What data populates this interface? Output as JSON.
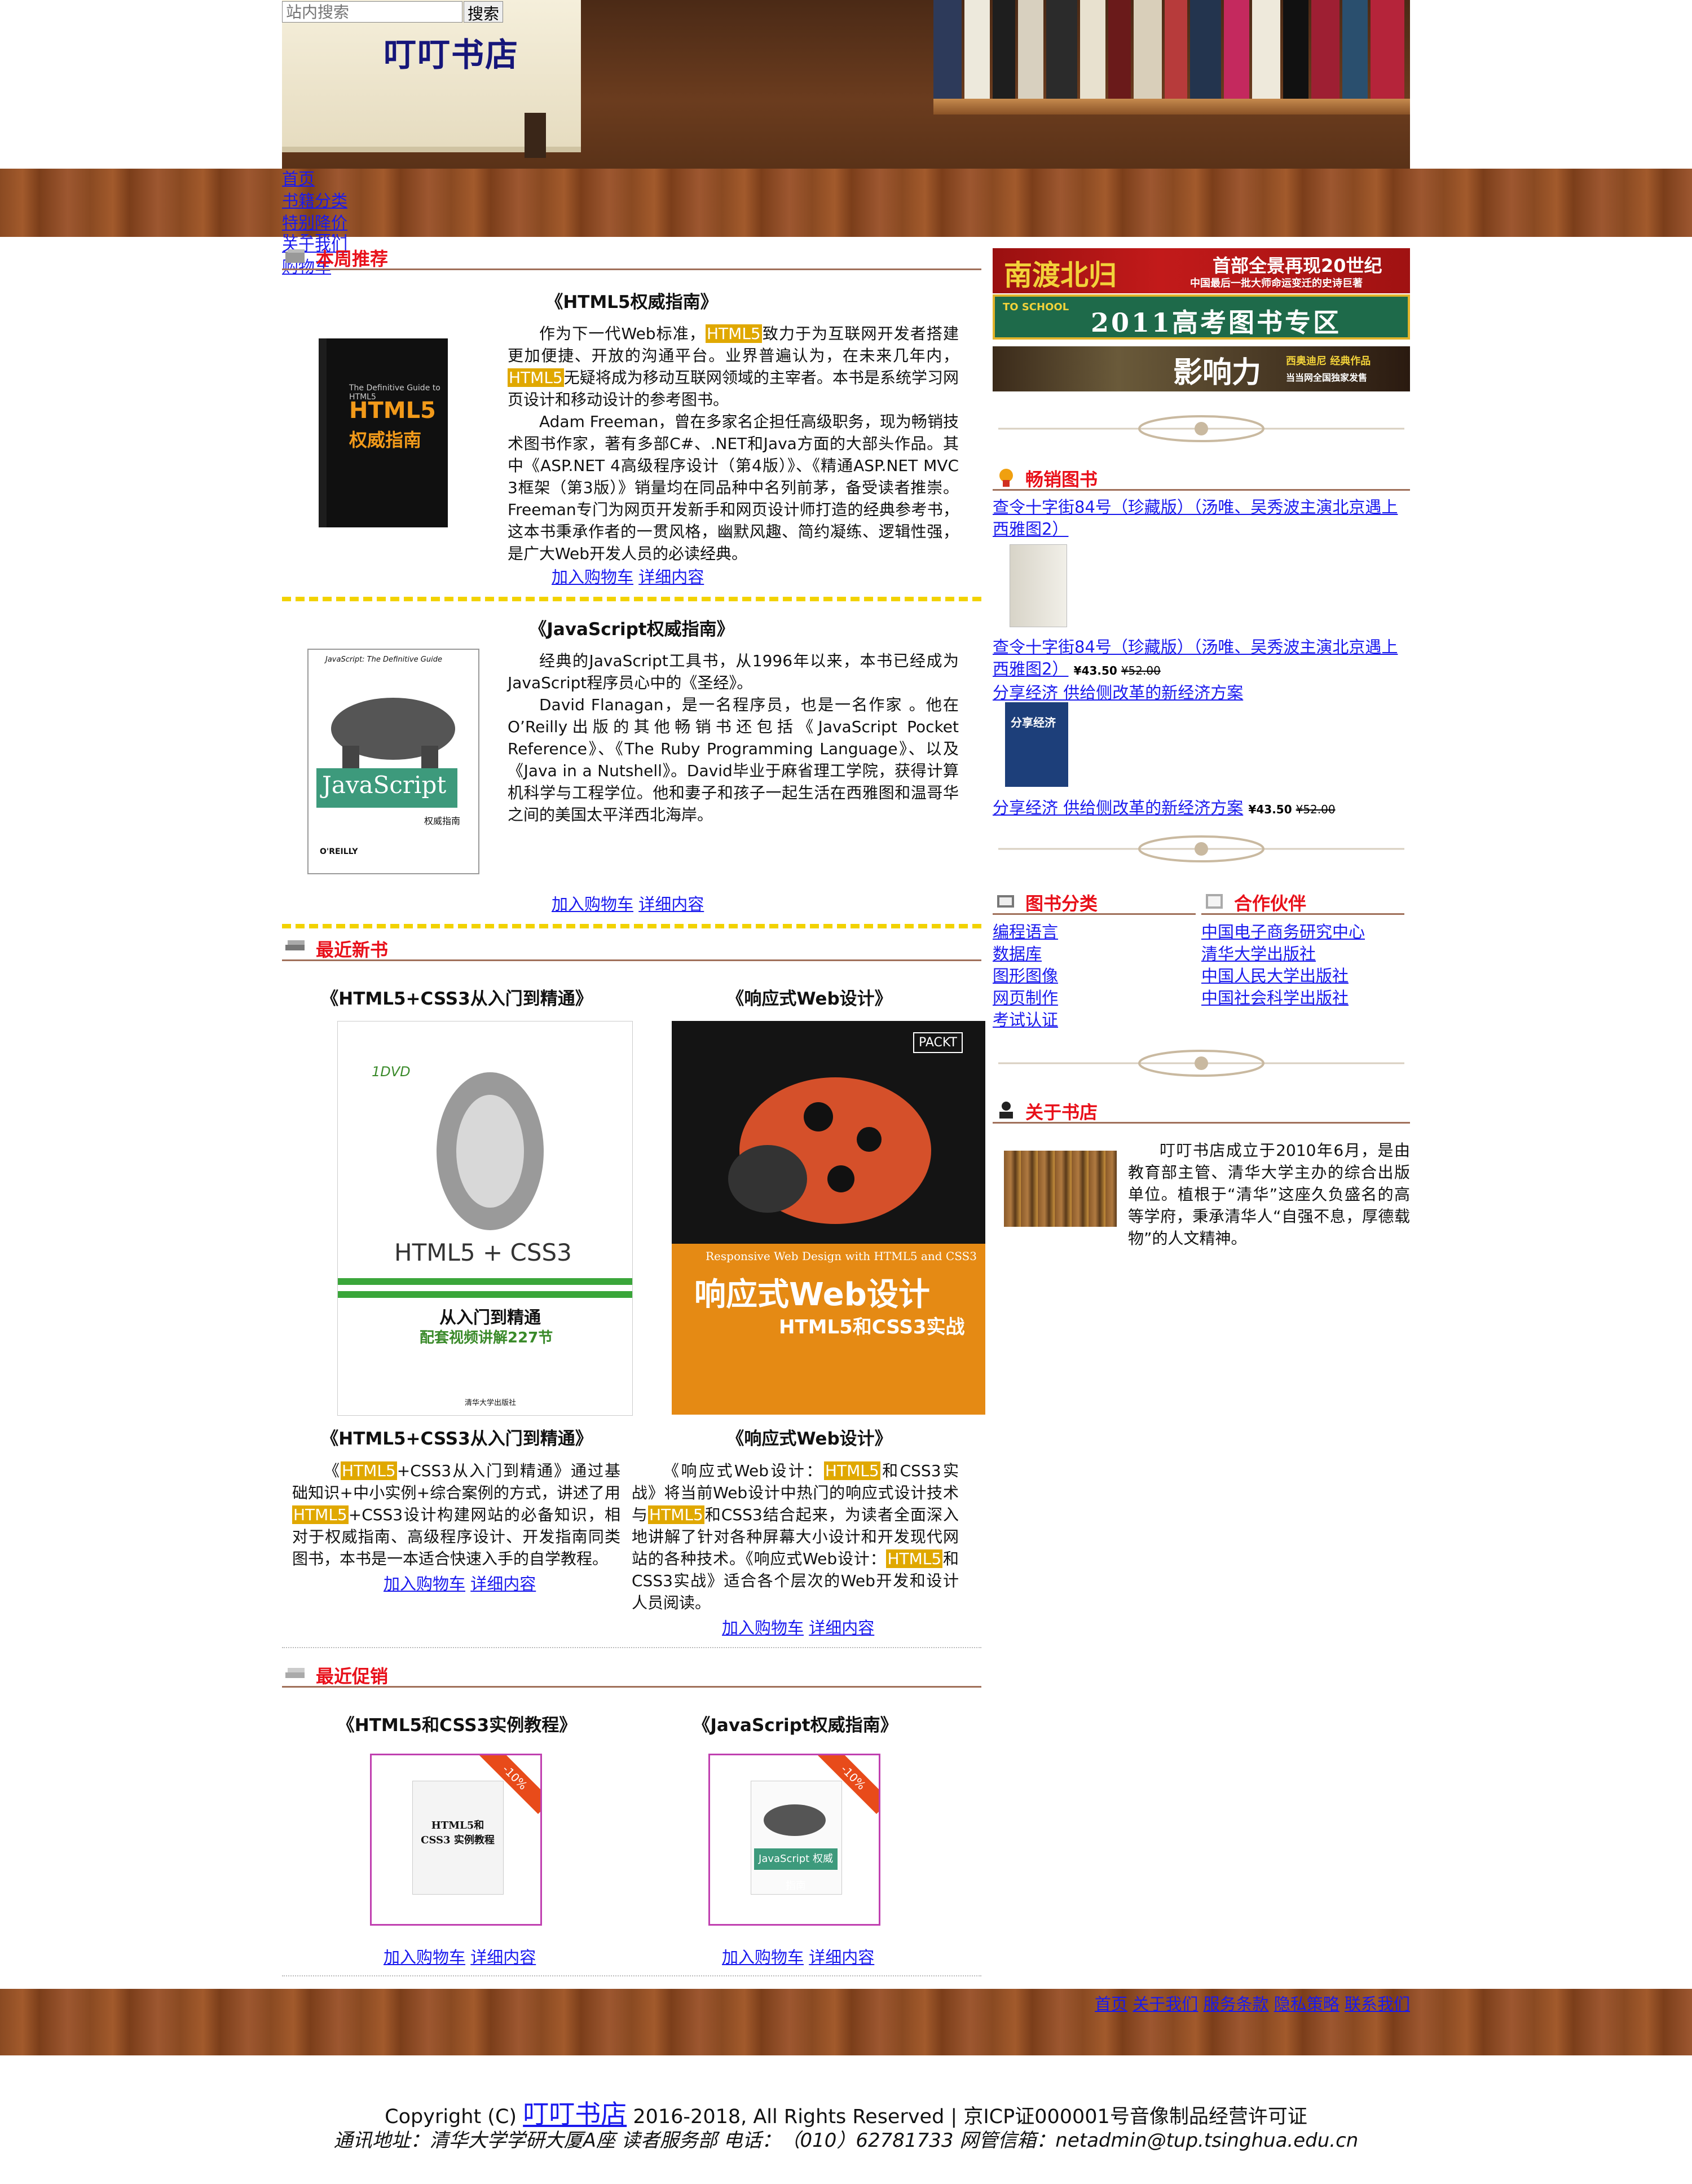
{
  "header": {
    "search_placeholder": "站内搜索",
    "search_button": "搜索",
    "site_title": "叮叮书店"
  },
  "nav": [
    "首页",
    "书籍分类",
    "特别降价",
    "联系我们",
    "关于我们",
    "购物车"
  ],
  "recommend": {
    "title": "本周推荐",
    "books": [
      {
        "title": "《HTML5权威指南》",
        "paragraphs": [
          [
            "作为下一代Web标准，",
            "HTML5",
            "致力于为互联网开发者搭建更加便捷、开放的沟通平台。业界普遍认为，在未来几年内，",
            "HTML5",
            "无疑将成为移动互联网领域的主宰者。本书是系统学习网页设计和移动设计的参考图书。"
          ],
          [
            "Adam Freeman，曾在多家名企担任高级职务，现为畅销技术图书作家，著有多部C#、.NET和Java方面的大部头作品。其中《ASP.NET 4高级程序设计（第4版）》、《精通ASP.NET MVC 3框架（第3版）》销量均在同品种中名列前茅，备受读者推崇。Freeman专门为网页开发新手和网页设计师打造的经典参考书，这本书秉承作者的一贯风格，幽默风趣、简约凝练、逻辑性强，是广大Web开发人员的必读经典。"
          ]
        ],
        "cover": {
          "line1": "HTML5",
          "line2": "权威指南",
          "line0": "The Definitive Guide to HTML5"
        }
      },
      {
        "title": "《JavaScript权威指南》",
        "paragraphs": [
          [
            "经典的JavaScript工具书，从1996年以来，本书已经成为JavaScript程序员心中的《圣经》。"
          ],
          [
            "David Flanagan，是一名程序员，也是一名作家 。他在O’Reilly出版的其他畅销书还包括《JavaScript Pocket Reference》、《The Ruby Programming Language》、以及《Java in a Nutshell》。David毕业于麻省理工学院，获得计算机科学与工程学位。他和妻子和孩子一起生活在西雅图和温哥华之间的美国太平洋西北海岸。"
          ]
        ],
        "cover": {
          "line0": "JavaScript: The Definitive Guide",
          "line1": "JavaScript",
          "line2": "权威指南"
        }
      }
    ],
    "add_cart": "加入购物车",
    "details": "详细内容"
  },
  "newbooks": {
    "title": "最近新书",
    "books": [
      {
        "title": "《HTML5+CSS3从入门到精通》",
        "cover": {
          "line1": "HTML5 + CSS3",
          "line2": "从入门到精通",
          "line3": "配套视频讲解227节",
          "line4": "清华大学出版社",
          "badge": "1DVD"
        },
        "desc": [
          "《",
          "HTML5",
          "+CSS3从入门到精通》通过基础知识+中小实例+综合案例的方式，讲述了用",
          "HTML5",
          "+CSS3设计构建网站的必备知识，相对于权威指南、高级程序设计、开发指南同类图书，本书是一本适合快速入手的自学教程。"
        ]
      },
      {
        "title": "《响应式Web设计》",
        "cover": {
          "line0": "Responsive Web Design with HTML5 and CSS3",
          "line1": "响应式Web设计",
          "line2": "HTML5和CSS3实战",
          "badge": "PACKT"
        },
        "desc": [
          "《响应式Web设计：",
          "HTML5",
          "和CSS3实战》将当前Web设计中热门的响应式设计技术与",
          "HTML5",
          "和CSS3结合起来，为读者全面深入地讲解了针对各种屏幕大小设计和开发现代网站的各种技术。《响应式Web设计：",
          "HTML5",
          "和CSS3实战》适合各个层次的Web开发和设计人员阅读。"
        ]
      }
    ]
  },
  "promo": {
    "title": "最近促销",
    "books": [
      {
        "title": "《HTML5和CSS3实例教程》",
        "ribbon": "-10%",
        "cover_text": "HTML5和CSS3 实例教程"
      },
      {
        "title": "《JavaScript权威指南》",
        "ribbon": "-10%",
        "cover_text": "JavaScript 权威指南"
      }
    ]
  },
  "ads": [
    {
      "big": "南渡北归",
      "small1": "首部全景再现20世纪",
      "small2": "中国最后一批大师命运变迁的史诗巨著"
    },
    {
      "big": "2011高考图书专区",
      "small1": "TO SCHOOL"
    },
    {
      "big": "影响力",
      "small1": "西奥迪尼 经典作品",
      "small2": "当当网全国独家发售"
    }
  ],
  "bestsellers": {
    "title": "畅销图书",
    "items": [
      {
        "link": "查令十字街84号（珍藏版）（汤唯、吴秀波主演北京遇上西雅图2）"
      },
      {
        "link": "查令十字街84号（珍藏版）（汤唯、吴秀波主演北京遇上西雅图2）",
        "price": "¥43.50",
        "old": "¥52.00"
      },
      {
        "link": "分享经济 供给侧改革的新经济方案",
        "cover": "分享经济"
      },
      {
        "link": "分享经济 供给侧改革的新经济方案",
        "price": "¥43.50",
        "old": "¥52.00"
      }
    ]
  },
  "categories": {
    "title": "图书分类",
    "items": [
      "编程语言",
      "数据库",
      "图形图像",
      "网页制作",
      "考试认证"
    ]
  },
  "partners": {
    "title": "合作伙伴",
    "items": [
      "中国电子商务研究中心",
      "清华大学出版社",
      "中国人民大学出版社",
      "中国社会科学出版社"
    ]
  },
  "about": {
    "title": "关于书店",
    "text": "叮叮书店成立于2010年6月，是由教育部主管、清华大学主办的综合出版单位。植根于“清华”这座久负盛名的高等学府，秉承清华人“自强不息，厚德载物”的人文精神。"
  },
  "footer": {
    "links": [
      "首页",
      "关于我们",
      "服务条款",
      "隐私策略",
      "联系我们"
    ],
    "copyright_prefix": "Copyright (C)",
    "copyright_brand": "叮叮书店",
    "copyright_suffix": "2016-2018, All Rights Reserved | 京ICP证000001号音像制品经营许可证",
    "address": "通讯地址：清华大学学研大厦A座 读者服务部  电话：（010）62781733  网管信箱：netadmin@tup.tsinghua.edu.cn"
  },
  "colors": {
    "accent_red": "#e8101a",
    "link_blue": "#1a1aee",
    "highlight": "#e0a800",
    "divider_yellow": "#f2d200",
    "wood": "#8a4a22"
  }
}
